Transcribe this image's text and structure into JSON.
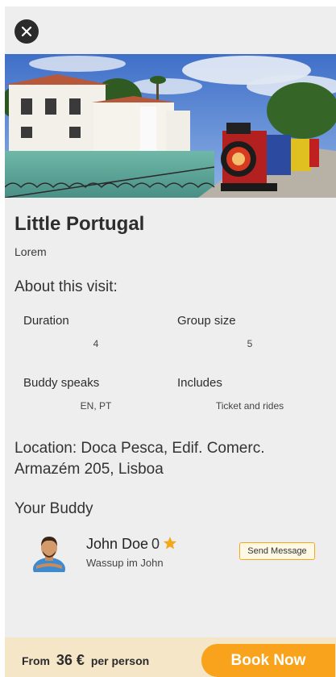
{
  "window": {
    "close_icon": "close-icon"
  },
  "hero": {
    "image_desc": "photo"
  },
  "place": {
    "title": "Little Portugal",
    "subtitle": "Lorem"
  },
  "about": {
    "heading": "About this visit:",
    "duration_label": "Duration",
    "duration_value": "4",
    "group_label": "Group size",
    "group_value": "5",
    "speaks_label": "Buddy speaks",
    "speaks_value": "EN, PT",
    "includes_label": "Includes",
    "includes_value": "Ticket and rides"
  },
  "location": {
    "text": "Location: Doca Pesca, Edif. Comerc. Armazém 205, Lisboa"
  },
  "buddy": {
    "heading": "Your Buddy",
    "name": "John Doe",
    "rating": "0",
    "tagline": "Wassup im John",
    "send_message_label": "Send Message",
    "star_color": "#f4a818"
  },
  "booking": {
    "from_label": "From",
    "price": "36 €",
    "per_label": "per person",
    "book_label": "Book Now",
    "accent": "#f9a21b"
  }
}
